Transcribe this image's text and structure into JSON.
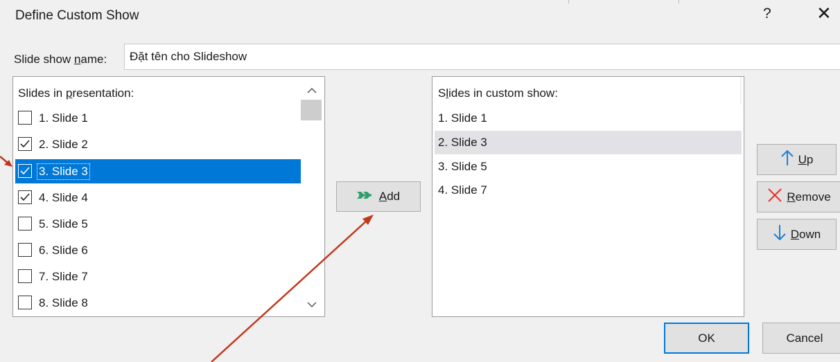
{
  "dialog": {
    "title": "Define Custom Show",
    "help": "?",
    "close": "✕"
  },
  "name_field": {
    "label_pre": "Slide show ",
    "label_key": "n",
    "label_post": "ame:",
    "value": "Đặt tên cho Slideshow"
  },
  "left_list": {
    "header_pre": "Slides in ",
    "header_key": "p",
    "header_post": "resentation:",
    "items": [
      {
        "label": "1. Slide 1",
        "checked": false,
        "selected": false
      },
      {
        "label": "2. Slide 2",
        "checked": true,
        "selected": false
      },
      {
        "label": "3. Slide 3",
        "checked": true,
        "selected": true
      },
      {
        "label": "4. Slide 4",
        "checked": true,
        "selected": false
      },
      {
        "label": "5. Slide 5",
        "checked": false,
        "selected": false
      },
      {
        "label": "6. Slide 6",
        "checked": false,
        "selected": false
      },
      {
        "label": "7. Slide 7",
        "checked": false,
        "selected": false
      },
      {
        "label": "8. Slide 8",
        "checked": false,
        "selected": false
      }
    ],
    "scroll_up": "⌃",
    "scroll_down": "⌄"
  },
  "add_button": {
    "icon": "double-arrow-right-icon",
    "key": "A",
    "rest": "dd"
  },
  "right_list": {
    "header_pre": "S",
    "header_key": "l",
    "header_post": "ides in custom show:",
    "items": [
      {
        "label": "1. Slide 1",
        "selected": false
      },
      {
        "label": "2. Slide 3",
        "selected": true
      },
      {
        "label": "3. Slide 5",
        "selected": false
      },
      {
        "label": "4. Slide 7",
        "selected": false
      }
    ]
  },
  "side_buttons": {
    "up": {
      "key": "U",
      "rest": "p",
      "icon": "arrow-up-icon"
    },
    "remove": {
      "key": "R",
      "rest": "emove",
      "icon": "x-icon"
    },
    "down": {
      "key": "D",
      "rest": "own",
      "icon": "arrow-down-icon"
    }
  },
  "footer": {
    "ok": "OK",
    "cancel": "Cancel"
  },
  "colors": {
    "selection": "#0078d7",
    "add_icon": "#2e9e6b",
    "up_down_icon": "#1e7fd1",
    "remove_icon": "#e8312e",
    "annotation_arrow": "#c0391b"
  }
}
